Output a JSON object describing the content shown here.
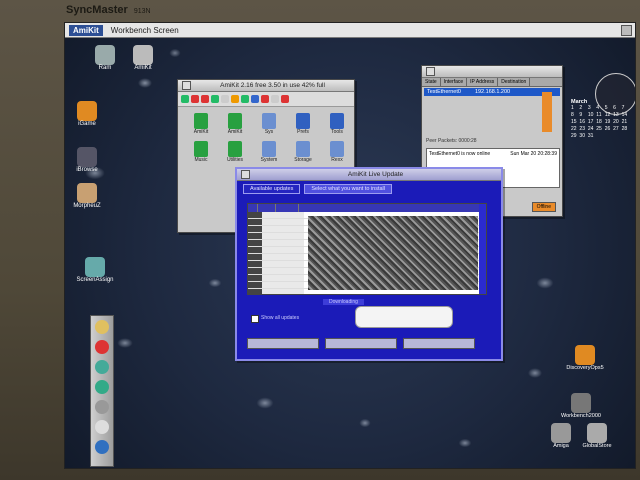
{
  "monitor": {
    "brand": "SyncMaster",
    "model": "913N"
  },
  "menubar": {
    "logo": "AmiKit",
    "title": "Workbench Screen"
  },
  "desktop_left_icons": [
    {
      "label": "Ram",
      "color": "#9aa"
    },
    {
      "label": "AmiKit",
      "color": "#bbb"
    },
    {
      "label": "iGame",
      "color": "#e08a22"
    },
    {
      "label": "iBrowse",
      "color": "#556"
    },
    {
      "label": "MorpheuZ",
      "color": "#c8a072"
    },
    {
      "label": "ScreenAssign",
      "color": "#6aa"
    }
  ],
  "amikit_window": {
    "title": "AmiKit   2.16 free 3.50 in use 42% full",
    "icons": [
      {
        "label": "AmiKit",
        "color": "#28a040"
      },
      {
        "label": "AmiKit",
        "color": "#28a040"
      },
      {
        "label": "Sys",
        "color": "#6b8fd0"
      },
      {
        "label": "Prefs",
        "color": "#3060c0"
      },
      {
        "label": "Tools",
        "color": "#3060c0"
      },
      {
        "label": "Music",
        "color": "#28a040"
      },
      {
        "label": "Utilities",
        "color": "#28a040"
      },
      {
        "label": "System",
        "color": "#6b8fd0"
      },
      {
        "label": "Storage",
        "color": "#6b8fd0"
      },
      {
        "label": "Rexx",
        "color": "#6b8fd0"
      }
    ],
    "toolbar_colors": [
      "#2b6",
      "#d33",
      "#d33",
      "#2b6",
      "#ccc",
      "#e90",
      "#2b6",
      "#36c",
      "#d33",
      "#ccc",
      "#d33"
    ]
  },
  "network_window": {
    "columns": [
      "State",
      "Interface",
      "IP Address",
      "Destination"
    ],
    "row": {
      "interface": "TestEthernet0",
      "ip": "192.168.1.200"
    },
    "info": "Peer Packets: 0000:28",
    "log_message": "TestEthernet0 is now online",
    "log_time": "Sun Mar 20 20:28:39",
    "offline_button": "Offline"
  },
  "update_window": {
    "title": "AmiKit Live Update",
    "tabs": [
      "Available updates",
      "Select what you want to install"
    ],
    "progress_label": "Downloading",
    "checkbox_label": "Show all updates",
    "buttons": [
      "",
      "",
      ""
    ]
  },
  "calendar": {
    "month": "March",
    "days": [
      "1",
      "2",
      "3",
      "4",
      "5",
      "6",
      "7",
      "8",
      "9",
      "10",
      "11",
      "12",
      "13",
      "14",
      "15",
      "16",
      "17",
      "18",
      "19",
      "20",
      "21",
      "22",
      "23",
      "24",
      "25",
      "26",
      "27",
      "28",
      "29",
      "30",
      "31"
    ]
  },
  "desktop_right_icons": [
    {
      "label": "DiscoveryOps5",
      "color": "#e08a22"
    },
    {
      "label": "Workbench2000",
      "color": "#777"
    },
    {
      "label": "Amiga",
      "color": "#999"
    },
    {
      "label": "GlobalStore",
      "color": "#aaa"
    }
  ],
  "dock_colors": [
    "#e0c060",
    "#d33",
    "#4a9",
    "#3a8",
    "#999",
    "#ddd",
    "#3070c0"
  ]
}
